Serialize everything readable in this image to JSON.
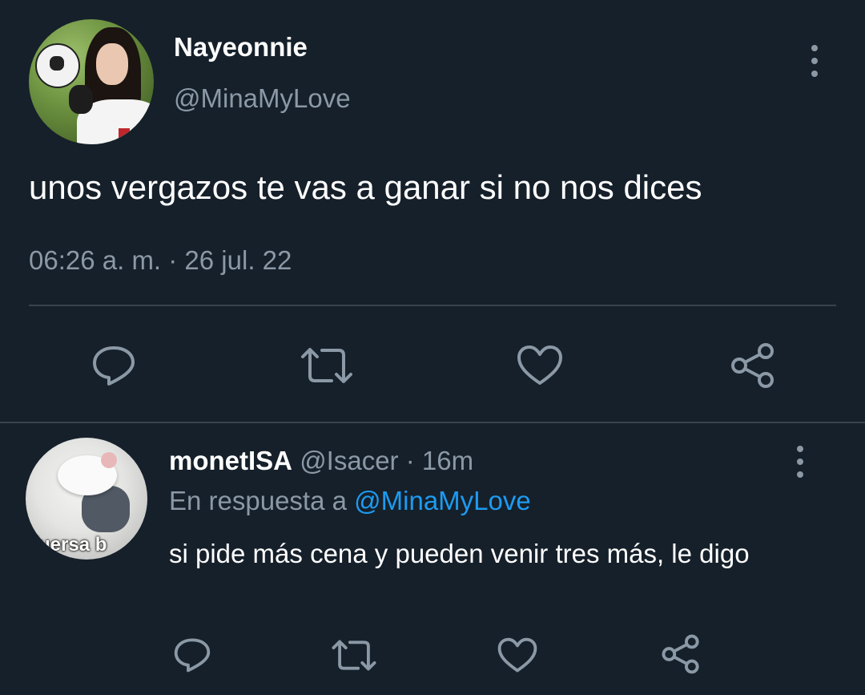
{
  "main_tweet": {
    "author": {
      "display_name": "Nayeonnie",
      "handle": "@MinaMyLove"
    },
    "text": "unos vergazos te vas a ganar si no nos dices",
    "timestamp": "06:26 a. m. · 26 jul. 22",
    "actions": [
      "reply-icon",
      "retweet-icon",
      "like-icon",
      "share-icon"
    ]
  },
  "reply": {
    "author": {
      "display_name": "monetISA",
      "handle": "@Isacer",
      "time": "· 16m"
    },
    "avatar_caption": "fuersa b",
    "in_reply_to_prefix": "En respuesta a",
    "in_reply_to": "@MinaMyLove",
    "text": "si pide más cena y pueden venir tres más, le digo",
    "actions": [
      "reply-icon",
      "retweet-icon",
      "like-icon",
      "share-icon"
    ]
  },
  "colors": {
    "background": "#15202b",
    "primary_text": "#ffffff",
    "secondary_text": "#8b98a5",
    "divider": "#38444d",
    "link": "#1d9bf0"
  }
}
